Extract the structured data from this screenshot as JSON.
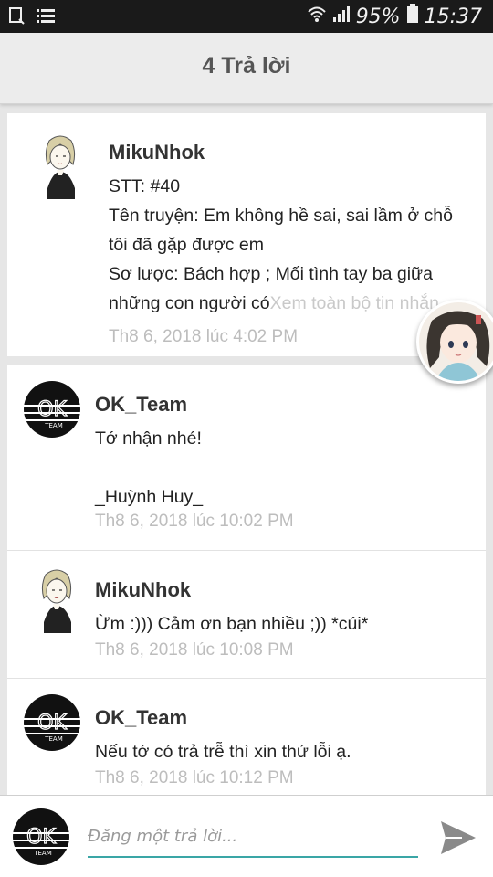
{
  "status_bar": {
    "battery_percent": "95%",
    "time": "15:37",
    "icons": [
      "notification-icon",
      "menu-list-icon",
      "wifi-icon",
      "signal-icon",
      "battery-icon"
    ]
  },
  "header": {
    "title": "4 Trả lời"
  },
  "posts": [
    {
      "author": "MikuNhok",
      "avatar": "sketch-girl-avatar",
      "lines": [
        "STT: #40",
        "Tên truyện: Em không hề sai, sai lầm ở chỗ",
        "tôi đã gặp được em",
        "Sơ lược: Bách hợp ; Mối tình tay ba giữa",
        "những con người có"
      ],
      "more_link": "Xem toàn bộ tin nhắn",
      "time": "Th8 6, 2018 lúc 4:02 PM"
    },
    {
      "author": "OK_Team",
      "avatar": "ok-team-avatar",
      "lines": [
        "Tớ nhận nhé!",
        "",
        "_Huỳnh Huy_"
      ],
      "time": "Th8 6, 2018 lúc 10:02 PM"
    },
    {
      "author": "MikuNhok",
      "avatar": "sketch-girl-avatar",
      "lines": [
        "Ừm :))) Cảm ơn bạn nhiều ;)) *cúi*"
      ],
      "time": "Th8 6, 2018 lúc 10:08 PM"
    },
    {
      "author": "OK_Team",
      "avatar": "ok-team-avatar",
      "lines": [
        "Nếu tớ có trả trễ thì xin thứ lỗi ạ."
      ],
      "time": "Th8 6, 2018 lúc 10:12 PM"
    }
  ],
  "composer": {
    "placeholder": "Đăng một trả lời...",
    "value": ""
  },
  "colors": {
    "accent_underline": "#3aa6a6",
    "timestamp": "#bdbdbd",
    "header_bg": "#ececec"
  }
}
